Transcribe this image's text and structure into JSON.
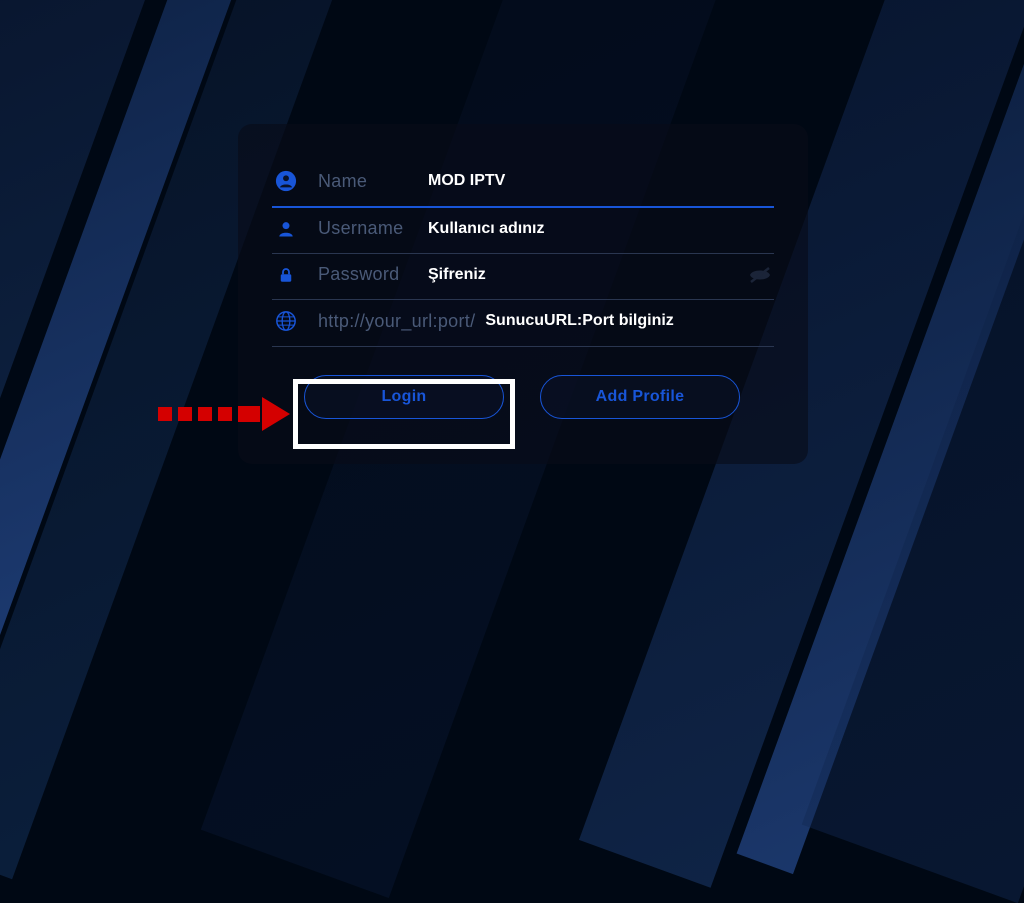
{
  "form": {
    "name": {
      "label": "Name",
      "value": "MOD IPTV"
    },
    "username": {
      "label": "Username",
      "value": "Kullanıcı adınız"
    },
    "password": {
      "label": "Password",
      "value": "Şifreniz"
    },
    "url": {
      "placeholder": "http://your_url:port/",
      "value": "SunucuURL:Port bilginiz"
    }
  },
  "buttons": {
    "login": "Login",
    "add_profile": "Add Profile"
  },
  "colors": {
    "accent": "#1855d8",
    "muted": "#4a5a78",
    "annotation": "#d40000"
  }
}
